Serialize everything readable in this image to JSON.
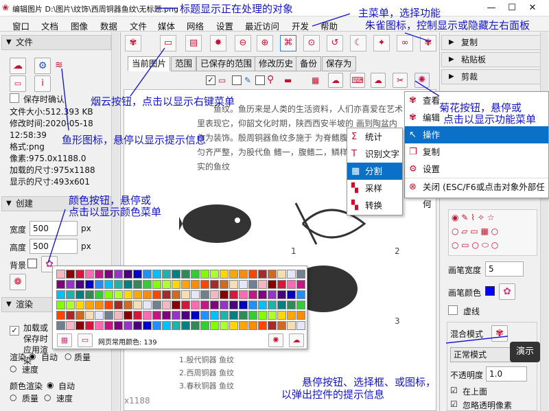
{
  "window": {
    "title": "编辑图片 D:\\图片\\纹饰\\西周铜器鱼纹\\无标题.png",
    "minimize": "—",
    "maximize": "☐",
    "close": "✕"
  },
  "menubar": [
    "窗口",
    "文档",
    "图像",
    "数据",
    "文件",
    "媒体",
    "网络",
    "设置",
    "最近访问",
    "开发",
    "帮助"
  ],
  "left": {
    "file_section": "文件",
    "save_confirm": "保存时确认",
    "info": [
      "文件大小:512.393 KB",
      "修改时间:2020-05-18",
      "12:58:39",
      "格式:png",
      "像素:975.0x1188.0",
      "加载的尺寸:975x1188",
      "显示的尺寸:493x601"
    ],
    "create_section": "创建",
    "width_label": "宽度",
    "width_value": "500",
    "width_unit": "px",
    "height_label": "高度",
    "height_value": "500",
    "height_unit": "px",
    "bg_label": "背景",
    "render_section": "渲染",
    "render_check": "加载或保存时应用渲染",
    "render_label": "渲染",
    "render_auto": "自动",
    "render_quality": "质量",
    "render_speed": "速度",
    "color_render_label": "颜色渲染",
    "color_auto": "自动",
    "color_quality": "质量",
    "color_speed": "速度"
  },
  "tabs": [
    "当前图片",
    "范围",
    "已保存的范围",
    "修改历史",
    "备份",
    "保存为"
  ],
  "right": {
    "sections": [
      "复制",
      "粘贴板",
      "剪裁"
    ],
    "pen_width_label": "画笔宽度",
    "pen_width_value": "5",
    "pen_color_label": "画笔颜色",
    "dashed_label": "虚线",
    "blend_label": "混合模式",
    "blend_value": "正常模式",
    "opacity_label": "不透明度",
    "opacity_value": "1.0",
    "on_top_label": "在上面",
    "ignore_label": "忽略透明像素"
  },
  "right_menu": {
    "items": [
      {
        "icon": "eye-icon",
        "label": "查看"
      },
      {
        "icon": "pencil-icon",
        "label": "编辑"
      },
      {
        "icon": "cursor-icon",
        "label": "操作"
      },
      {
        "icon": "copy-icon",
        "label": "复制"
      },
      {
        "icon": "gear-icon",
        "label": "设置"
      },
      {
        "icon": "close-icon",
        "label": "关闭 (ESC/F6或点击对象外部任何"
      }
    ]
  },
  "sub_menu": {
    "items": [
      {
        "icon": "sigma-icon",
        "label": "统计"
      },
      {
        "icon": "text-icon",
        "label": "识别文字"
      },
      {
        "icon": "grid-icon",
        "label": "分割"
      },
      {
        "icon": "sample-icon",
        "label": "采样"
      },
      {
        "icon": "convert-icon",
        "label": "转换"
      }
    ]
  },
  "palette": {
    "footer": "网页常用颜色: 139"
  },
  "tooltip": "演示",
  "document_text": {
    "para": "鱼纹。鱼历来是人类的生活资料，人们亦喜爱在艺术 里表现它，仰韶文化时期，陕西西安半坡的 画到陶盆内作为装饰。殷周铜器鱼纹多施于 为脊鳍腹鳍各二，结构匀齐严整，为股代鱼 鳍一，腹鳍二，鳞样道真，表现写实的鱼纹",
    "num1": "1",
    "num2": "2",
    "num3": "3",
    "captions": [
      "1.殷代铜器 鱼纹",
      "2.西周铜器 鱼纹",
      "3.春秋铜器 鱼纹"
    ],
    "x1188": "x1188"
  },
  "annotations": {
    "title": "标题显示正在处理的对象",
    "menu": "主菜单，选择功能",
    "peacock": "朱雀图标，控制显示或隐藏左右面板",
    "cloud": "烟云按钮，点击以显示右键菜单",
    "fish": "鱼形图标，悬停以显示提示信息",
    "chrys1": "菊花按钮，悬停或",
    "chrys2": "点击以显示功能菜单",
    "color1": "颜色按钮，悬停或",
    "color2": "点击以显示颜色菜单",
    "hover1": "悬停按钮、选择框、或图标，",
    "hover2": "以弹出控件的提示信息"
  }
}
